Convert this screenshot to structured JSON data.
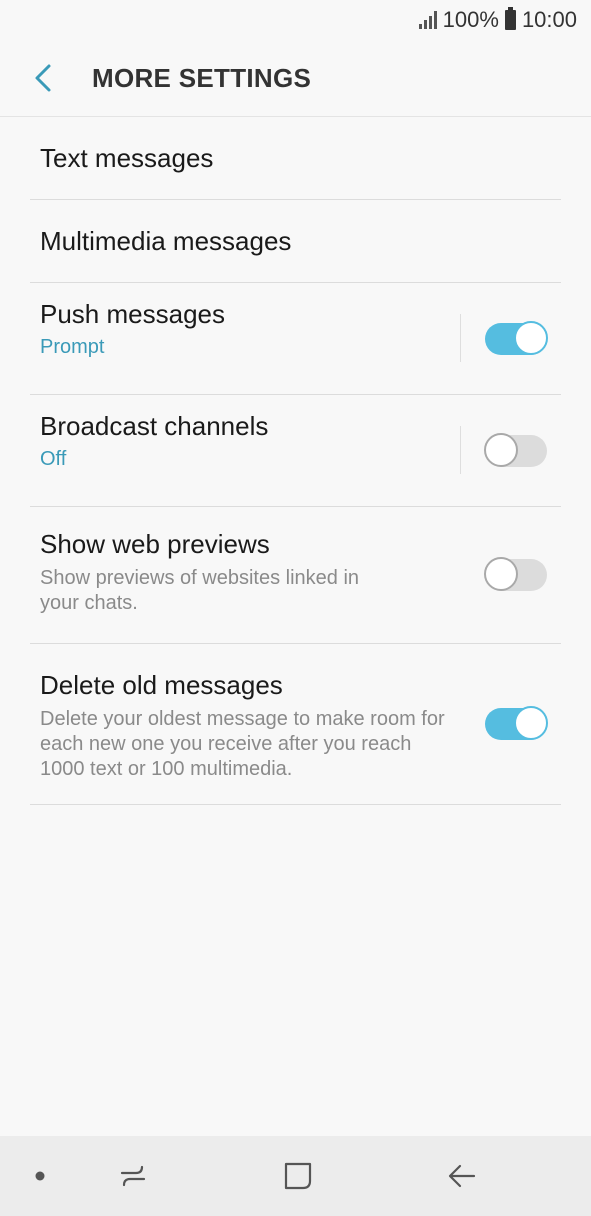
{
  "status_bar": {
    "battery_percent": "100%",
    "time": "10:00"
  },
  "header": {
    "title": "MORE SETTINGS",
    "back_icon": "chevron-left-icon"
  },
  "settings": [
    {
      "id": "text-messages",
      "title": "Text messages"
    },
    {
      "id": "multimedia-messages",
      "title": "Multimedia messages"
    },
    {
      "id": "push-messages",
      "title": "Push messages",
      "subtitle": "Prompt",
      "toggle": true
    },
    {
      "id": "broadcast-channels",
      "title": "Broadcast channels",
      "subtitle": "Off",
      "toggle": false
    },
    {
      "id": "show-web-previews",
      "title": "Show web previews",
      "description": "Show previews of websites linked in your chats.",
      "toggle": false
    },
    {
      "id": "delete-old-messages",
      "title": "Delete old messages",
      "description": "Delete your oldest message to make room for each new one you receive after you reach 1000 text or 100 multimedia.",
      "toggle": true
    }
  ],
  "colors": {
    "accent": "#3a9ab8",
    "toggle_on": "#55bde0"
  },
  "nav_bar": {
    "icons": [
      "dot-icon",
      "recent-apps-icon",
      "home-icon",
      "back-icon"
    ]
  }
}
